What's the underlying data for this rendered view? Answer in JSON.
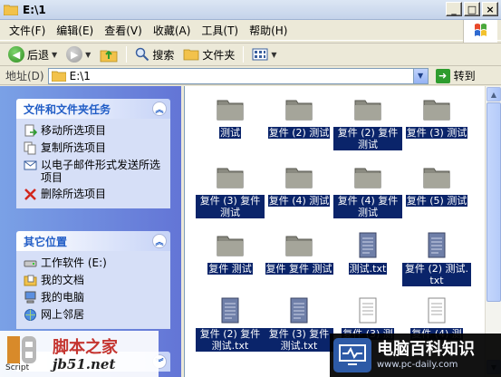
{
  "window": {
    "title": "E:\\1",
    "buttons": {
      "minimize": "_",
      "maximize": "□",
      "close": "×"
    }
  },
  "menu": [
    "文件(F)",
    "编辑(E)",
    "查看(V)",
    "收藏(A)",
    "工具(T)",
    "帮助(H)"
  ],
  "toolbar": {
    "back_label": "后退",
    "search_label": "搜索",
    "folders_label": "文件夹"
  },
  "address": {
    "label": "地址(D)",
    "value": "E:\\1",
    "go_label": "转到"
  },
  "tasks_panel": {
    "title": "文件和文件夹任务",
    "items": [
      {
        "label": "移动所选项目",
        "icon": "move-icon"
      },
      {
        "label": "复制所选项目",
        "icon": "copy-icon"
      },
      {
        "label": "以电子邮件形式发送所选项目",
        "icon": "email-icon"
      },
      {
        "label": "删除所选项目",
        "icon": "delete-icon"
      }
    ]
  },
  "places_panel": {
    "title": "其它位置",
    "items": [
      {
        "label": "工作软件 (E:)",
        "icon": "drive-icon"
      },
      {
        "label": "我的文档",
        "icon": "my-documents-icon"
      },
      {
        "label": "我的电脑",
        "icon": "my-computer-icon"
      },
      {
        "label": "网上邻居",
        "icon": "network-icon"
      }
    ]
  },
  "files": [
    {
      "name": "测试",
      "type": "folder"
    },
    {
      "name": "复件 (2) 测试",
      "type": "folder"
    },
    {
      "name": "复件 (2) 复件 测试",
      "type": "folder"
    },
    {
      "name": "复件 (3) 测试",
      "type": "folder"
    },
    {
      "name": "复件 (3) 复件 测试",
      "type": "folder"
    },
    {
      "name": "复件 (4) 测试",
      "type": "folder"
    },
    {
      "name": "复件 (4) 复件 测试",
      "type": "folder"
    },
    {
      "name": "复件 (5) 测试",
      "type": "folder"
    },
    {
      "name": "复件 测试",
      "type": "folder"
    },
    {
      "name": "复件 复件 测试",
      "type": "folder"
    },
    {
      "name": "测试.txt",
      "type": "text"
    },
    {
      "name": "复件 (2) 测试.txt",
      "type": "text"
    },
    {
      "name": "复件 (2) 复件 测试.txt",
      "type": "text"
    },
    {
      "name": "复件 (3) 复件 测试.txt",
      "type": "text"
    },
    {
      "name": "复件 (3) 测",
      "type": "text"
    },
    {
      "name": "复件 (4) 测",
      "type": "text"
    }
  ],
  "watermarks": {
    "left_title": "脚本之家",
    "left_url": "jb51.net",
    "left_script": "Script",
    "right_title": "电脑百科知识",
    "right_url": "www.pc-daily.com"
  },
  "colors": {
    "selection": "#0a246a",
    "taskpane_top": "#7aa1e6",
    "taskpane_bottom": "#6375d6",
    "panel_head_text": "#215dc6"
  }
}
